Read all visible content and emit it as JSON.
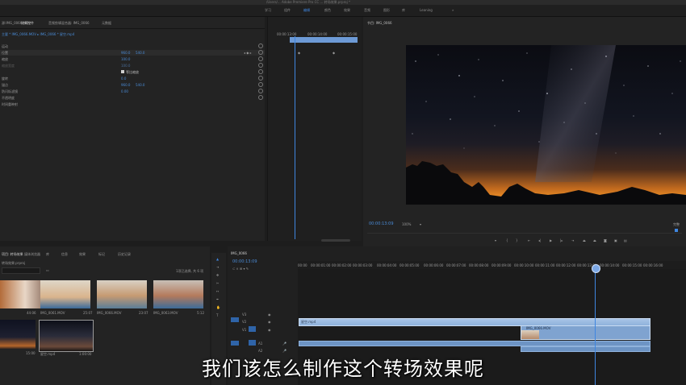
{
  "app": {
    "title_bar": "/Users/... Adobe Premiere Pro CC ... 转场效果.prproj *"
  },
  "workspace_tabs": [
    "学习",
    "组件",
    "编辑",
    "颜色",
    "效果",
    "音频",
    "图形",
    "库",
    "Leaning",
    "»"
  ],
  "effect_controls": {
    "tabs": [
      "源:IMG_0066.MOV",
      "效果控件",
      "音频剪辑混合器: IMG_0066",
      "元数据"
    ],
    "source_line": "主要 * IMG_0066.MOV  ▸  IMG_0066 * 星空.mp4",
    "rows": [
      {
        "label": "运动",
        "v1": "",
        "v2": ""
      },
      {
        "label": "位置",
        "v1": "960.0",
        "v2": "540.0"
      },
      {
        "label": "缩放",
        "v1": "100.0",
        "v2": ""
      },
      {
        "label": "缩放宽度",
        "v1": "100.0",
        "v2": ""
      },
      {
        "label": "",
        "v1": "等比缩放",
        "v2": ""
      },
      {
        "label": "旋转",
        "v1": "0.0",
        "v2": ""
      },
      {
        "label": "锚点",
        "v1": "960.0",
        "v2": "540.0"
      },
      {
        "label": "防闪烁滤镜",
        "v1": "0.00",
        "v2": ""
      },
      {
        "label": "不透明度",
        "v1": "",
        "v2": ""
      },
      {
        "label": "时间重映射",
        "v1": "",
        "v2": ""
      }
    ],
    "timeline_times": [
      "00:00:13:00",
      "00:00:14:00",
      "00:00:15:00"
    ],
    "clip_bar_label": "IMG_0066.MOV"
  },
  "program_monitor": {
    "title": "节目: IMG_0066",
    "timecode": "00:00:13:09",
    "zoom": "100%",
    "quality": "完整",
    "controls": [
      "add-marker-icon",
      "in-point-icon",
      "out-point-icon",
      "go-to-in-icon",
      "step-back-icon",
      "play-icon",
      "step-forward-icon",
      "go-to-out-icon",
      "lift-icon",
      "extract-icon",
      "export-frame-icon",
      "button-editor-icon"
    ]
  },
  "project": {
    "tabs": [
      "项目: 转场效果",
      "媒体浏览器",
      "库",
      "信息",
      "效果",
      "标记",
      "历史记录"
    ],
    "project_file": "转场效果.prproj",
    "search_placeholder": "",
    "selection_info": "1项已选择, 共 6 项",
    "thumbnails": [
      {
        "name": "",
        "duration": "44:06"
      },
      {
        "name": "IMG_0061.MOV",
        "duration": "25:07"
      },
      {
        "name": "IMG_0066.MOV",
        "duration": "23:07"
      },
      {
        "name": "IMG_0063.MOV",
        "duration": "5:12"
      },
      {
        "name": "",
        "duration": "15:00"
      },
      {
        "name": "星空.mp4",
        "duration": "1:00:00"
      }
    ]
  },
  "timeline": {
    "tab": "IMG_0066",
    "timecode": "00:00:13:09",
    "ruler": [
      "00:00",
      "00:00:01:00",
      "00:00:02:00",
      "00:00:03:00",
      "00:00:04:00",
      "00:00:05:00",
      "00:00:06:00",
      "00:00:07:00",
      "00:00:08:00",
      "00:00:09:00",
      "00:00:10:00",
      "00:00:11:00",
      "00:00:12:00",
      "00:00:13:00",
      "00:00:14:00",
      "00:00:15:00",
      "00:00:16:00",
      "00:00:17:00",
      "00:00:18:00"
    ],
    "tracks": [
      "V3",
      "V2",
      "V1",
      "A1",
      "A2"
    ],
    "clip_v1_label": "星空.mp4",
    "clip_v2_label": "IMG_0066.MOV"
  },
  "subtitle": "我们该怎么制作这个转场效果呢",
  "colors": {
    "accent": "#3f86e0",
    "panel": "#232323",
    "clip": "#a8c4e6"
  }
}
